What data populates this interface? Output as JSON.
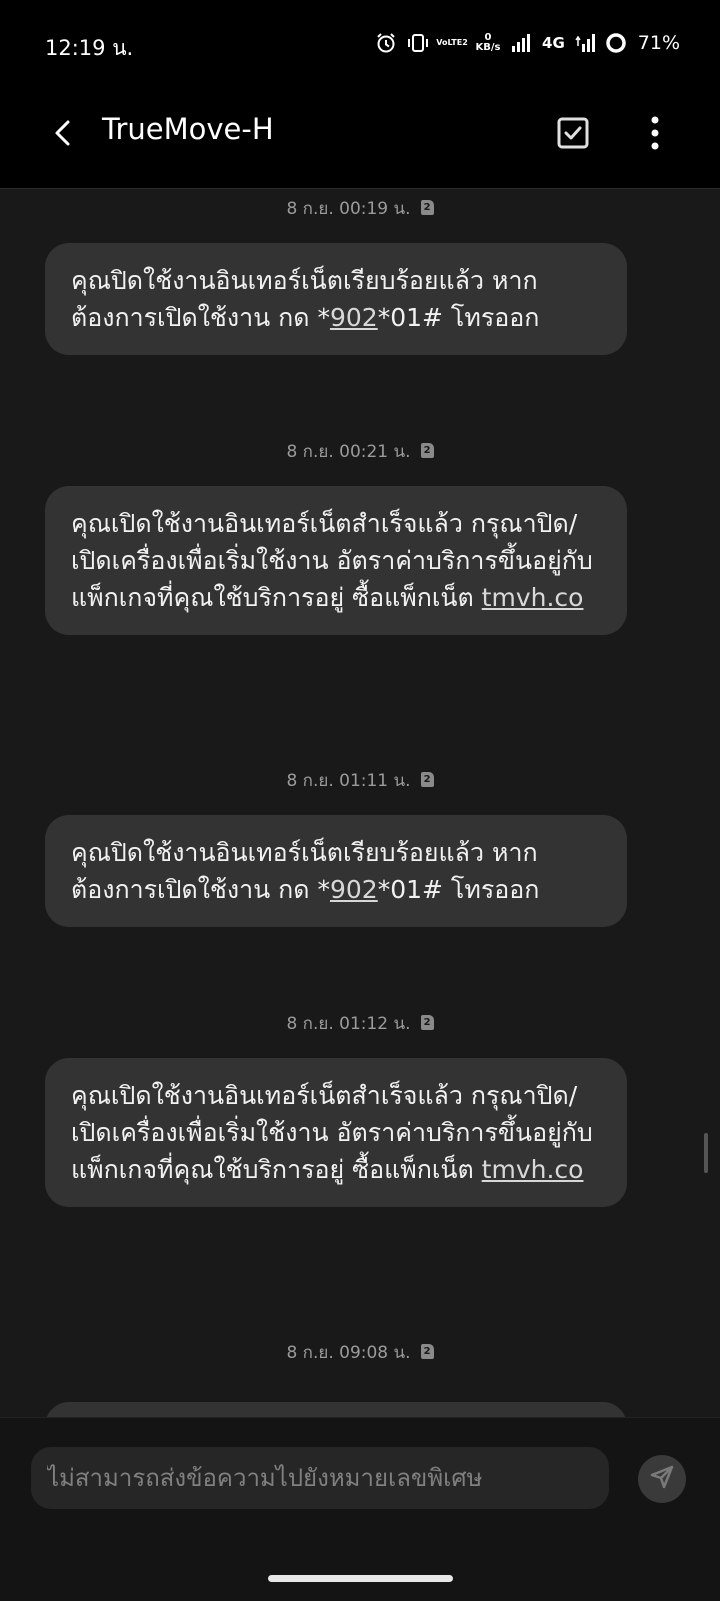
{
  "status_bar": {
    "time": "12:19 น.",
    "volte_label": "VoLTE2",
    "data_speed_value": "0",
    "data_speed_unit": "KB/s",
    "network_label": "4G",
    "battery_percent": "71%"
  },
  "app_bar": {
    "title": "TrueMove-H"
  },
  "messages": [
    {
      "timestamp": "8 ก.ย. 00:19 น.",
      "sim": "2",
      "pre": "คุณปิดใช้งานอินเทอร์เน็ตเรียบร้อยแล้ว หากต้องการเปิดใช้งาน กด *",
      "link": "902",
      "post": "*01# โทรออก"
    },
    {
      "timestamp": "8 ก.ย. 00:21 น.",
      "sim": "2",
      "pre": "คุณเปิดใช้งานอินเทอร์เน็ตสำเร็จแล้ว กรุณาปิด/เปิดเครื่องเพื่อเริ่มใช้งาน อัตราค่าบริการขึ้นอยู่กับแพ็กเกจที่คุณใช้บริการอยู่ ซื้อแพ็กเน็ต ",
      "link": "tmvh.co",
      "post": ""
    },
    {
      "timestamp": "8 ก.ย. 01:11 น.",
      "sim": "2",
      "pre": "คุณปิดใช้งานอินเทอร์เน็ตเรียบร้อยแล้ว หากต้องการเปิดใช้งาน กด *",
      "link": "902",
      "post": "*01# โทรออก"
    },
    {
      "timestamp": "8 ก.ย. 01:12 น.",
      "sim": "2",
      "pre": "คุณเปิดใช้งานอินเทอร์เน็ตสำเร็จแล้ว กรุณาปิด/เปิดเครื่องเพื่อเริ่มใช้งาน อัตราค่าบริการขึ้นอยู่กับแพ็กเกจที่คุณใช้บริการอยู่ ซื้อแพ็กเน็ต ",
      "link": "tmvh.co",
      "post": ""
    },
    {
      "timestamp": "8 ก.ย. 09:08 น.",
      "sim": "2"
    }
  ],
  "composer": {
    "placeholder": "ไม่สามารถส่งข้อความไปยังหมายเลขพิเศษ"
  }
}
